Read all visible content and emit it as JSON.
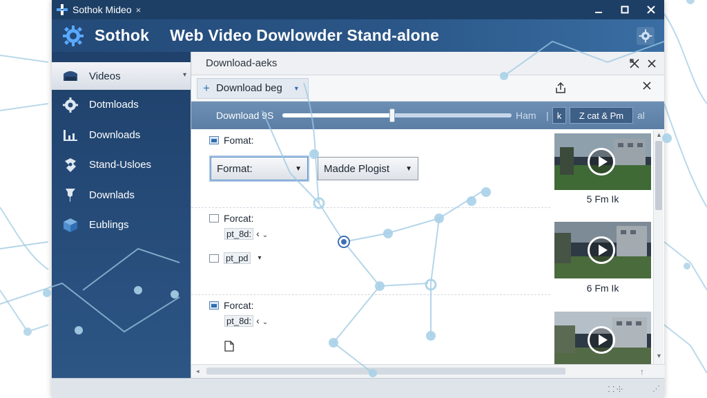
{
  "window": {
    "title": "Sothok Mideo",
    "title_close": "×",
    "controls": [
      "minimize-icon",
      "maximize-icon",
      "close-icon"
    ]
  },
  "header": {
    "brand": "Sothok",
    "title": "Web Video Dowlowder Stand-alone",
    "settings_icon": "gear-icon"
  },
  "sidebar": {
    "items": [
      {
        "label": "Videos",
        "icon": "video-folder-icon",
        "active": true
      },
      {
        "label": "Dotmloads",
        "icon": "gear-icon"
      },
      {
        "label": "Downloads",
        "icon": "bar-chart-icon"
      },
      {
        "label": "Stand-Usloes",
        "icon": "puzzle-icon"
      },
      {
        "label": "Downlads",
        "icon": "pin-icon"
      },
      {
        "label": "Eublings",
        "icon": "cube-icon"
      }
    ]
  },
  "panel": {
    "title": "Download-aeks",
    "tab_label": "Download beg"
  },
  "progress": {
    "label": "Download 9S",
    "fraction": 0.48,
    "hmm_text": "Ham",
    "k_button": "k",
    "zcat_button": "Z cat & Pm",
    "trailing_text": "al"
  },
  "options": {
    "format_header": "Fomat:",
    "format_select": "Format:",
    "playlist_select": "Madde Plogist",
    "section2_title": "Forcat:",
    "section2_field1": "pt_8d:",
    "section2_field2": "pt_pd",
    "section3_title": "Forcat:",
    "section3_field1": "pt_8d:"
  },
  "thumbnails": [
    {
      "caption": "5 Fm Ik"
    },
    {
      "caption": "6 Fm Ik"
    },
    {
      "caption": ""
    }
  ],
  "status": {
    "icons_text": "⸬ ⸭"
  }
}
